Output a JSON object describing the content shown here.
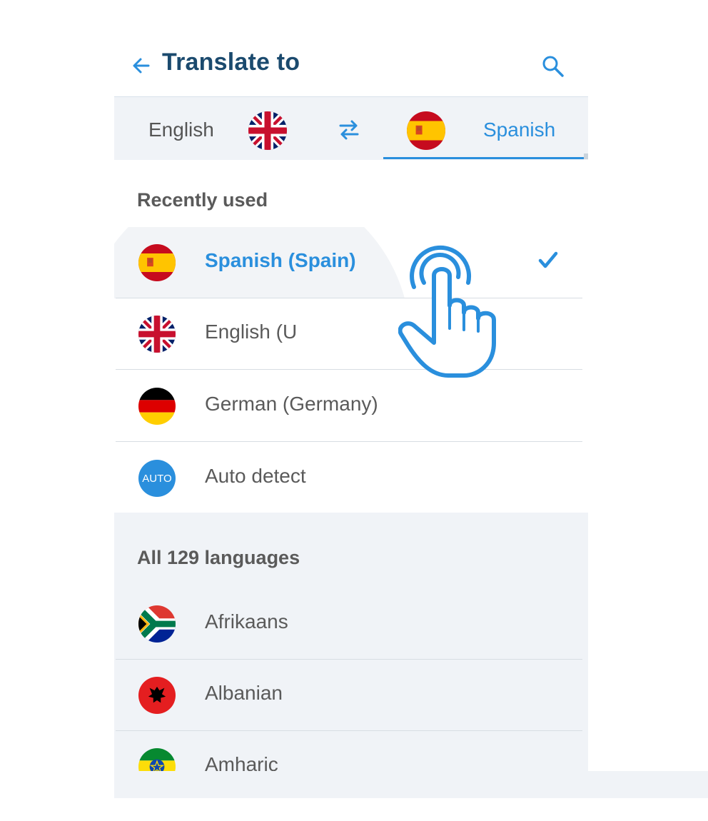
{
  "header": {
    "title": "Translate to"
  },
  "langbar": {
    "source_label": "English",
    "target_label": "Spanish"
  },
  "recent": {
    "title": "Recently used",
    "items": [
      {
        "label": "Spanish (Spain)",
        "selected": true
      },
      {
        "label": "English (U"
      },
      {
        "label": "German (Germany)"
      },
      {
        "label": "Auto detect",
        "badge": "AUTO"
      }
    ]
  },
  "all": {
    "title": "All 129 languages",
    "items": [
      {
        "label": "Afrikaans"
      },
      {
        "label": "Albanian"
      },
      {
        "label": "Amharic"
      }
    ]
  },
  "colors": {
    "accent": "#2a8fdd",
    "title": "#1b4a6e",
    "text": "#5a5a5a",
    "panel_bg": "#f0f3f7"
  }
}
